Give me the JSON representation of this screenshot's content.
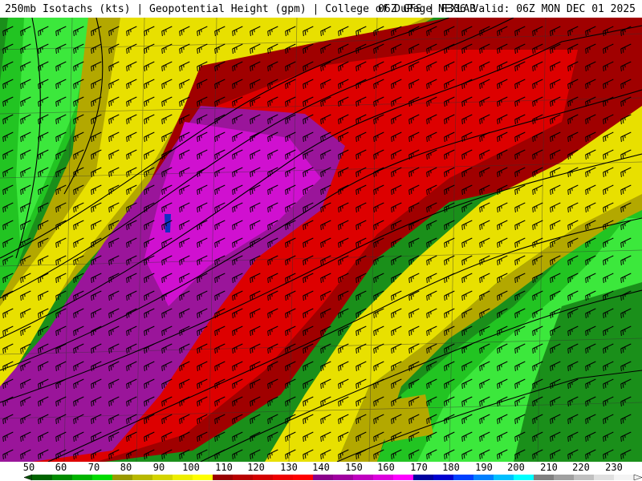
{
  "header": {
    "left": "250mb Isotachs (kts) | Geopotential Height (gpm) | College of DuPage NEXLAB",
    "right": "06Z GFS | F336 Valid: 06Z MON DEC 01 2025"
  },
  "legend": {
    "labels": [
      "50",
      "60",
      "70",
      "80",
      "90",
      "100",
      "110",
      "120",
      "130",
      "140",
      "150",
      "160",
      "170",
      "180",
      "190",
      "200",
      "210",
      "220",
      "230"
    ],
    "colors": [
      "#006400",
      "#008c00",
      "#00b400",
      "#00dc00",
      "#9a9a00",
      "#b8b800",
      "#d4d400",
      "#eeee00",
      "#ffff00",
      "#9a0000",
      "#b80000",
      "#d40000",
      "#ee0000",
      "#ff0000",
      "#8b008b",
      "#a000a0",
      "#c000c0",
      "#dd00dd",
      "#ff00ff",
      "#0000a0",
      "#0000d0",
      "#0040ff",
      "#0080ff",
      "#00c0ff",
      "#00ffff",
      "#808080",
      "#a0a0a0",
      "#c0c0c0",
      "#e0e0e0",
      "#f4f4f4"
    ]
  },
  "map": {
    "colors": {
      "green_dark": "#1a8f1a",
      "green": "#22c422",
      "green_bright": "#3ce83c",
      "olive": "#b3a800",
      "yellow": "#e8e000",
      "red_dark": "#a00000",
      "red": "#dd0000",
      "purple": "#9a159a",
      "magenta": "#d010d0",
      "blue": "#1030c0"
    }
  }
}
